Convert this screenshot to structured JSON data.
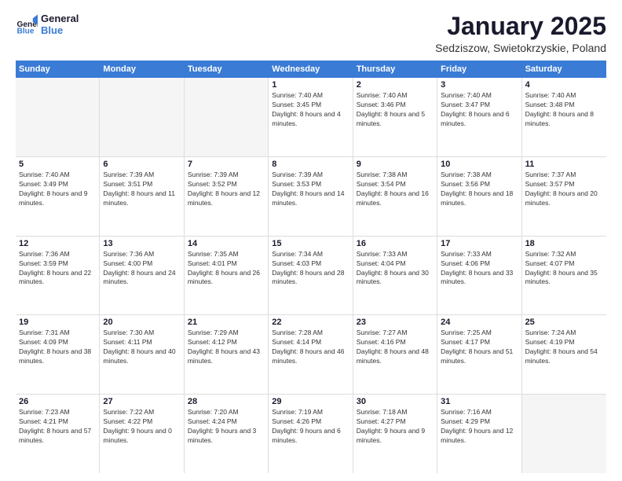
{
  "logo": {
    "line1": "General",
    "line2": "Blue"
  },
  "title": "January 2025",
  "location": "Sedziszow, Swietokrzyskie, Poland",
  "weekdays": [
    "Sunday",
    "Monday",
    "Tuesday",
    "Wednesday",
    "Thursday",
    "Friday",
    "Saturday"
  ],
  "weeks": [
    [
      {
        "day": "",
        "empty": true
      },
      {
        "day": "",
        "empty": true
      },
      {
        "day": "",
        "empty": true
      },
      {
        "day": "1",
        "sunrise": "7:40 AM",
        "sunset": "3:45 PM",
        "daylight": "8 hours and 4 minutes."
      },
      {
        "day": "2",
        "sunrise": "7:40 AM",
        "sunset": "3:46 PM",
        "daylight": "8 hours and 5 minutes."
      },
      {
        "day": "3",
        "sunrise": "7:40 AM",
        "sunset": "3:47 PM",
        "daylight": "8 hours and 6 minutes."
      },
      {
        "day": "4",
        "sunrise": "7:40 AM",
        "sunset": "3:48 PM",
        "daylight": "8 hours and 8 minutes."
      }
    ],
    [
      {
        "day": "5",
        "sunrise": "7:40 AM",
        "sunset": "3:49 PM",
        "daylight": "8 hours and 9 minutes."
      },
      {
        "day": "6",
        "sunrise": "7:39 AM",
        "sunset": "3:51 PM",
        "daylight": "8 hours and 11 minutes."
      },
      {
        "day": "7",
        "sunrise": "7:39 AM",
        "sunset": "3:52 PM",
        "daylight": "8 hours and 12 minutes."
      },
      {
        "day": "8",
        "sunrise": "7:39 AM",
        "sunset": "3:53 PM",
        "daylight": "8 hours and 14 minutes."
      },
      {
        "day": "9",
        "sunrise": "7:38 AM",
        "sunset": "3:54 PM",
        "daylight": "8 hours and 16 minutes."
      },
      {
        "day": "10",
        "sunrise": "7:38 AM",
        "sunset": "3:56 PM",
        "daylight": "8 hours and 18 minutes."
      },
      {
        "day": "11",
        "sunrise": "7:37 AM",
        "sunset": "3:57 PM",
        "daylight": "8 hours and 20 minutes."
      }
    ],
    [
      {
        "day": "12",
        "sunrise": "7:36 AM",
        "sunset": "3:59 PM",
        "daylight": "8 hours and 22 minutes."
      },
      {
        "day": "13",
        "sunrise": "7:36 AM",
        "sunset": "4:00 PM",
        "daylight": "8 hours and 24 minutes."
      },
      {
        "day": "14",
        "sunrise": "7:35 AM",
        "sunset": "4:01 PM",
        "daylight": "8 hours and 26 minutes."
      },
      {
        "day": "15",
        "sunrise": "7:34 AM",
        "sunset": "4:03 PM",
        "daylight": "8 hours and 28 minutes."
      },
      {
        "day": "16",
        "sunrise": "7:33 AM",
        "sunset": "4:04 PM",
        "daylight": "8 hours and 30 minutes."
      },
      {
        "day": "17",
        "sunrise": "7:33 AM",
        "sunset": "4:06 PM",
        "daylight": "8 hours and 33 minutes."
      },
      {
        "day": "18",
        "sunrise": "7:32 AM",
        "sunset": "4:07 PM",
        "daylight": "8 hours and 35 minutes."
      }
    ],
    [
      {
        "day": "19",
        "sunrise": "7:31 AM",
        "sunset": "4:09 PM",
        "daylight": "8 hours and 38 minutes."
      },
      {
        "day": "20",
        "sunrise": "7:30 AM",
        "sunset": "4:11 PM",
        "daylight": "8 hours and 40 minutes."
      },
      {
        "day": "21",
        "sunrise": "7:29 AM",
        "sunset": "4:12 PM",
        "daylight": "8 hours and 43 minutes."
      },
      {
        "day": "22",
        "sunrise": "7:28 AM",
        "sunset": "4:14 PM",
        "daylight": "8 hours and 46 minutes."
      },
      {
        "day": "23",
        "sunrise": "7:27 AM",
        "sunset": "4:16 PM",
        "daylight": "8 hours and 48 minutes."
      },
      {
        "day": "24",
        "sunrise": "7:25 AM",
        "sunset": "4:17 PM",
        "daylight": "8 hours and 51 minutes."
      },
      {
        "day": "25",
        "sunrise": "7:24 AM",
        "sunset": "4:19 PM",
        "daylight": "8 hours and 54 minutes."
      }
    ],
    [
      {
        "day": "26",
        "sunrise": "7:23 AM",
        "sunset": "4:21 PM",
        "daylight": "8 hours and 57 minutes."
      },
      {
        "day": "27",
        "sunrise": "7:22 AM",
        "sunset": "4:22 PM",
        "daylight": "9 hours and 0 minutes."
      },
      {
        "day": "28",
        "sunrise": "7:20 AM",
        "sunset": "4:24 PM",
        "daylight": "9 hours and 3 minutes."
      },
      {
        "day": "29",
        "sunrise": "7:19 AM",
        "sunset": "4:26 PM",
        "daylight": "9 hours and 6 minutes."
      },
      {
        "day": "30",
        "sunrise": "7:18 AM",
        "sunset": "4:27 PM",
        "daylight": "9 hours and 9 minutes."
      },
      {
        "day": "31",
        "sunrise": "7:16 AM",
        "sunset": "4:29 PM",
        "daylight": "9 hours and 12 minutes."
      },
      {
        "day": "",
        "empty": true
      }
    ]
  ]
}
